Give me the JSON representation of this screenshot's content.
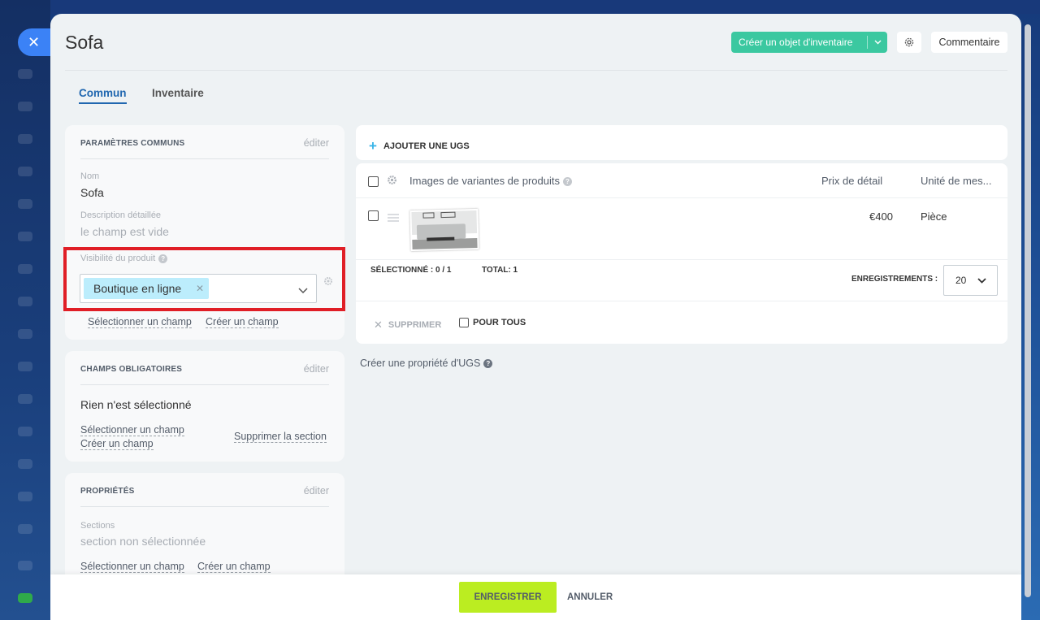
{
  "header": {
    "title": "Sofa",
    "create_inventory_label": "Créer un objet d'inventaire",
    "comment_label": "Commentaire"
  },
  "tabs": [
    {
      "label": "Commun",
      "active": true
    },
    {
      "label": "Inventaire",
      "active": false
    }
  ],
  "common_params": {
    "title": "PARAMÈTRES COMMUNS",
    "edit": "éditer",
    "name_label": "Nom",
    "name_value": "Sofa",
    "description_label": "Description détaillée",
    "description_value": "le champ est vide",
    "visibility_label": "Visibilité du produit",
    "visibility_tag": "Boutique en ligne",
    "select_field": "Sélectionner un champ",
    "create_field": "Créer un champ"
  },
  "required_fields": {
    "title": "CHAMPS OBLIGATOIRES",
    "edit": "éditer",
    "value": "Rien n'est sélectionné",
    "select_field": "Sélectionner un champ",
    "create_field": "Créer un champ",
    "delete_section": "Supprimer la section"
  },
  "properties": {
    "title": "PROPRIÉTÉS",
    "edit": "éditer",
    "sections_label": "Sections",
    "sections_value": "section non sélectionnée",
    "select_field": "Sélectionner un champ",
    "create_field": "Créer un champ"
  },
  "sku": {
    "add_label": "AJOUTER UNE UGS",
    "columns": [
      "Images de variantes de produits",
      "Prix de détail",
      "Unité de mes..."
    ],
    "rows": [
      {
        "price": "€400",
        "unit": "Pièce"
      }
    ],
    "selected_label": "SÉLECTIONNÉ :",
    "selected_value": "0 / 1",
    "total_label": "TOTAL:",
    "total_value": "1",
    "records_label": "ENREGISTREMENTS :",
    "records_value": "20",
    "delete_label": "SUPPRIMER",
    "for_all_label": "POUR TOUS",
    "create_property": "Créer une propriété d'UGS"
  },
  "footer": {
    "save_label": "ENREGISTRER",
    "cancel_label": "ANNULER"
  },
  "colors": {
    "accent_green": "#3bc8a0",
    "save_lime": "#bbed21",
    "tag_blue": "#bcedfc",
    "highlight_red": "#e01e26",
    "tab_blue": "#2067b0"
  }
}
